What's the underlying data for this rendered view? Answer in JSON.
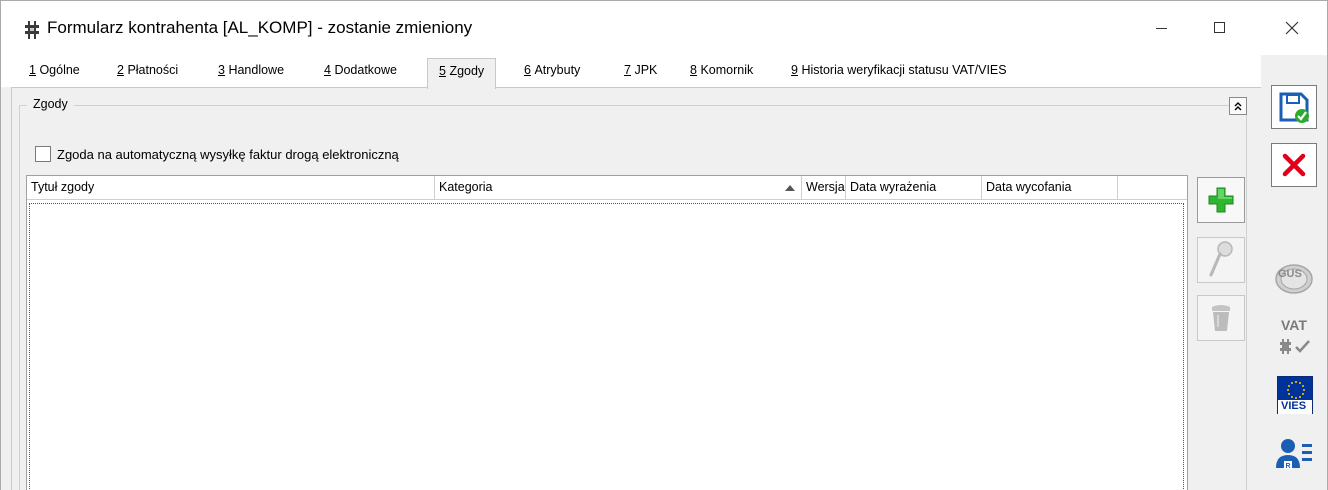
{
  "window": {
    "title": "Formularz kontrahenta [AL_KOMP] - zostanie zmieniony",
    "controls": [
      "minimize-icon",
      "maximize-icon",
      "close-icon"
    ]
  },
  "tabs": [
    {
      "num": "1",
      "label": "Ogólne",
      "active": false
    },
    {
      "num": "2",
      "label": "Płatności",
      "active": false
    },
    {
      "num": "3",
      "label": "Handlowe",
      "active": false
    },
    {
      "num": "4",
      "label": "Dodatkowe",
      "active": false
    },
    {
      "num": "5",
      "label": "Zgody",
      "active": true
    },
    {
      "num": "6",
      "label": "Atrybuty",
      "active": false
    },
    {
      "num": "7",
      "label": "JPK",
      "active": false
    },
    {
      "num": "8",
      "label": "Komornik",
      "active": false
    },
    {
      "num": "9",
      "label": "Historia weryfikacji statusu VAT/VIES",
      "active": false
    }
  ],
  "group": {
    "title": "Zgody",
    "collapse_icon": "double-chevron-up-icon"
  },
  "einvoice_consent": {
    "label": "Zgoda na automatyczną wysyłkę faktur drogą elektroniczną",
    "checked": false
  },
  "grid": {
    "columns": [
      {
        "label": "Tytuł zgody"
      },
      {
        "label": "Kategoria",
        "sorted": "ascending"
      },
      {
        "label": "Wersja"
      },
      {
        "label": "Data wyrażenia"
      },
      {
        "label": "Data wycofania"
      },
      {
        "label": ""
      }
    ],
    "rows": []
  },
  "grid_actions": [
    {
      "name": "add",
      "icon": "plus-icon",
      "enabled": true
    },
    {
      "name": "edit",
      "icon": "magnifier-icon",
      "enabled": false
    },
    {
      "name": "delete",
      "icon": "trash-icon",
      "enabled": false
    }
  ],
  "toolbar": [
    {
      "name": "save",
      "icon": "floppy-save-icon"
    },
    {
      "name": "cancel",
      "icon": "red-x-icon"
    },
    {
      "name": "gus",
      "icon": "gus-icon",
      "text": "GUS"
    },
    {
      "name": "vat",
      "icon": "vat-check-icon",
      "text": "VAT"
    },
    {
      "name": "vies",
      "icon": "eu-vies-icon",
      "text": "VIES"
    },
    {
      "name": "contact-card",
      "icon": "contact-card-icon"
    }
  ],
  "colors": {
    "accent_blue": "#1a5fb4",
    "cancel_red": "#e0001b",
    "add_green": "#2fb52f",
    "eu_blue": "#003399",
    "eu_star": "#ffcc00"
  }
}
